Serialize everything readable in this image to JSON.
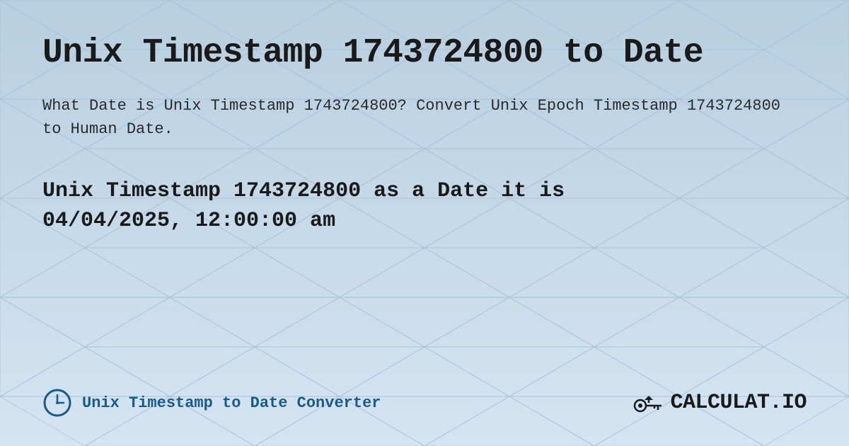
{
  "page": {
    "title": "Unix Timestamp 1743724800 to Date",
    "description": "What Date is Unix Timestamp 1743724800? Convert Unix Epoch Timestamp 1743724800 to Human Date.",
    "result_line1": "Unix Timestamp 1743724800 as a Date it is",
    "result_line2": "04/04/2025, 12:00:00 am",
    "footer_link": "Unix Timestamp to Date Converter",
    "logo_text": "CALCULAT.IO"
  },
  "colors": {
    "bg_start": "#b8cfe0",
    "bg_end": "#d4e4f0",
    "title_color": "#1a1a1a",
    "text_color": "#2a2a2a",
    "link_color": "#1a5a8a",
    "logo_color": "#1a1a1a"
  }
}
